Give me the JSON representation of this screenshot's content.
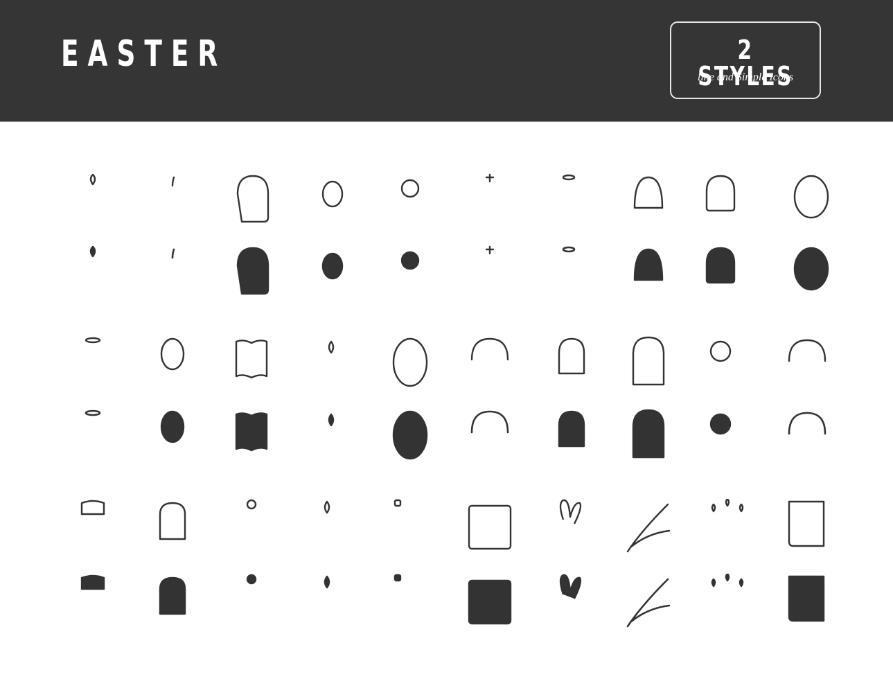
{
  "header": {
    "title": "EASTER",
    "badge_main": "2 STYLES",
    "badge_sub": "line and Simple Icons",
    "background_color": "#353535",
    "text_color": "#ffffff"
  },
  "icon_color": "#333333",
  "styles": [
    "line",
    "solid"
  ],
  "icon_groups": [
    {
      "row": 1,
      "icons": [
        {
          "name": "easter-basket-candle-icon"
        },
        {
          "name": "cupcake-cherry-icon"
        },
        {
          "name": "easter-cake-eggs-icon"
        },
        {
          "name": "hand-holding-egg-icon"
        },
        {
          "name": "chick-in-eggshell-icon"
        },
        {
          "name": "church-icon"
        },
        {
          "name": "angel-icon"
        },
        {
          "name": "egg-cross-ribbon-icon"
        },
        {
          "name": "easter-cake-candle-icon"
        },
        {
          "name": "egg-painting-brush-icon"
        }
      ]
    },
    {
      "row": 2,
      "icons": [
        {
          "name": "praying-angel-icon"
        },
        {
          "name": "egg-in-cup-icon"
        },
        {
          "name": "hands-holding-bible-icon"
        },
        {
          "name": "candle-icon"
        },
        {
          "name": "egg-with-cross-icon"
        },
        {
          "name": "basket-with-eggs-icon"
        },
        {
          "name": "hand-holding-cake-icon"
        },
        {
          "name": "nun-icon"
        },
        {
          "name": "chick-icon"
        },
        {
          "name": "basket-willow-icon"
        }
      ]
    },
    {
      "row": 3,
      "icons": [
        {
          "name": "priest-icon"
        },
        {
          "name": "grave-icon"
        },
        {
          "name": "sermon-icon"
        },
        {
          "name": "candle-holder-icon"
        },
        {
          "name": "wine-bottle-glass-icon"
        },
        {
          "name": "calendar-cross-icon"
        },
        {
          "name": "chocolate-bunny-icon"
        },
        {
          "name": "willow-branch-icon"
        },
        {
          "name": "advent-candles-icon"
        },
        {
          "name": "bible-icon"
        }
      ]
    }
  ]
}
